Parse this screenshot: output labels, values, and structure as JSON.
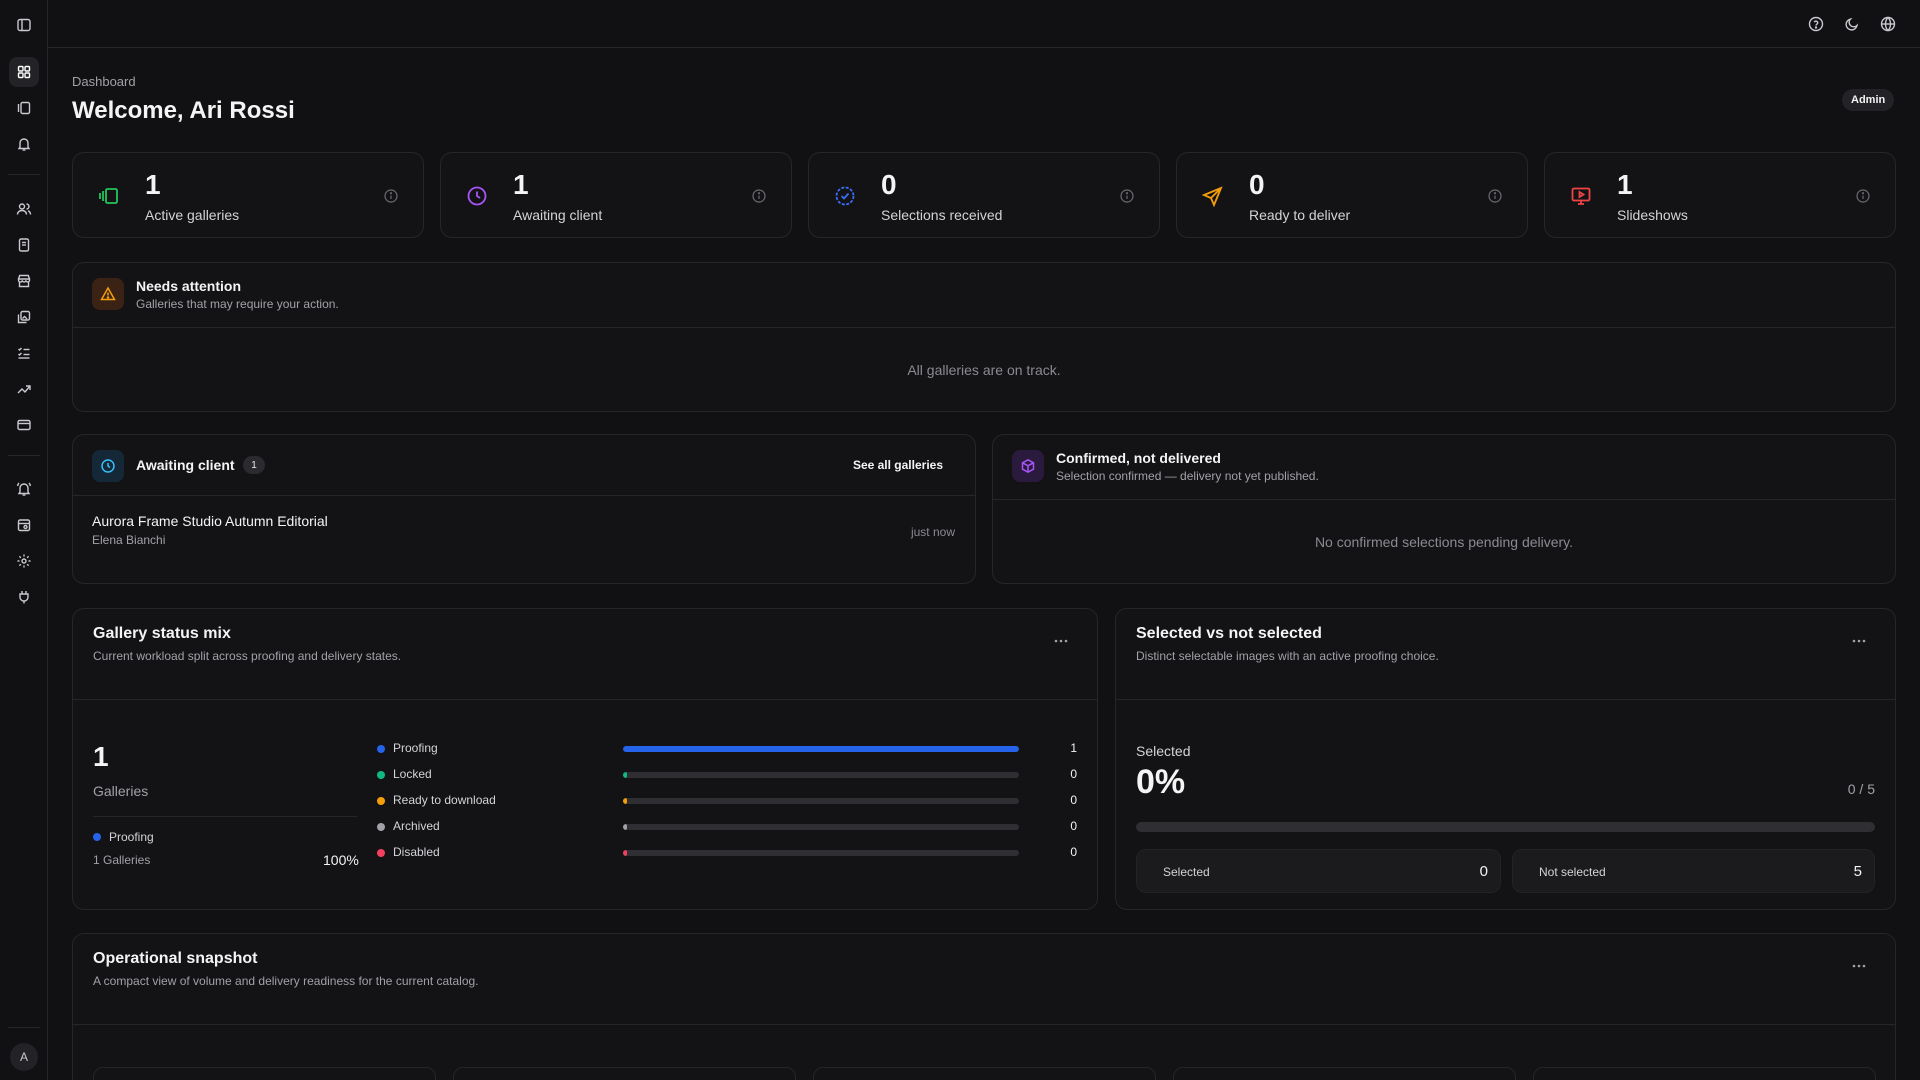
{
  "sidebar": {
    "items": [
      {
        "name": "sidebar-toggle-icon"
      },
      {
        "name": "dashboard-icon"
      },
      {
        "name": "galleries-icon"
      },
      {
        "name": "notifications-icon"
      },
      {
        "name": "clients-icon"
      },
      {
        "name": "invoices-icon"
      },
      {
        "name": "store-icon"
      },
      {
        "name": "images-icon"
      },
      {
        "name": "tasks-icon"
      },
      {
        "name": "analytics-icon"
      },
      {
        "name": "billing-icon"
      },
      {
        "name": "alerts-icon"
      },
      {
        "name": "calendar-settings-icon"
      },
      {
        "name": "settings-icon"
      },
      {
        "name": "integrations-icon"
      }
    ],
    "avatar_initial": "A"
  },
  "topbar": {
    "icons": [
      "help-icon",
      "theme-moon-icon",
      "language-globe-icon"
    ]
  },
  "header": {
    "breadcrumb": "Dashboard",
    "title": "Welcome, Ari Rossi",
    "role_badge": "Admin"
  },
  "stats": [
    {
      "value": "1",
      "label": "Active galleries",
      "icon": "gallery-stack-icon",
      "color": "#22c55e"
    },
    {
      "value": "1",
      "label": "Awaiting client",
      "icon": "clock-icon",
      "color": "#a855f7"
    },
    {
      "value": "0",
      "label": "Selections received",
      "icon": "check-circle-icon",
      "color": "#3b6cf6"
    },
    {
      "value": "0",
      "label": "Ready to deliver",
      "icon": "send-icon",
      "color": "#f59e0b"
    },
    {
      "value": "1",
      "label": "Slideshows",
      "icon": "presentation-icon",
      "color": "#ef4444"
    }
  ],
  "attention": {
    "title": "Needs attention",
    "subtitle": "Galleries that may require your action.",
    "empty": "All galleries are on track."
  },
  "awaiting": {
    "title": "Awaiting client",
    "count": "1",
    "link": "See all galleries",
    "items": [
      {
        "name": "Aurora Frame Studio Autumn Editorial",
        "client": "Elena Bianchi",
        "time": "just now"
      }
    ]
  },
  "confirmed": {
    "title": "Confirmed, not delivered",
    "subtitle": "Selection confirmed — delivery not yet published.",
    "empty": "No confirmed selections pending delivery."
  },
  "status_mix": {
    "title": "Gallery status mix",
    "subtitle": "Current workload split across proofing and delivery states.",
    "total": "1",
    "total_label": "Galleries",
    "legend_label": "Proofing",
    "legend_count": "1 Galleries",
    "legend_pct": "100%",
    "rows": [
      {
        "label": "Proofing",
        "count": "1",
        "fraction": 1.0,
        "color": "#2563eb"
      },
      {
        "label": "Locked",
        "count": "0",
        "fraction": 0.0,
        "color": "#10b981"
      },
      {
        "label": "Ready to download",
        "count": "0",
        "fraction": 0.0,
        "color": "#f59e0b"
      },
      {
        "label": "Archived",
        "count": "0",
        "fraction": 0.0,
        "color": "#a1a1aa"
      },
      {
        "label": "Disabled",
        "count": "0",
        "fraction": 0.0,
        "color": "#f43f5e"
      }
    ]
  },
  "selected": {
    "title": "Selected vs not selected",
    "subtitle": "Distinct selectable images with an active proofing choice.",
    "label": "Selected",
    "percent": "0%",
    "ratio": "0 / 5",
    "fraction": 0,
    "tiles": [
      {
        "label": "Selected",
        "value": "0"
      },
      {
        "label": "Not selected",
        "value": "5"
      }
    ]
  },
  "operational": {
    "title": "Operational snapshot",
    "subtitle": "A compact view of volume and delivery readiness for the current catalog."
  }
}
